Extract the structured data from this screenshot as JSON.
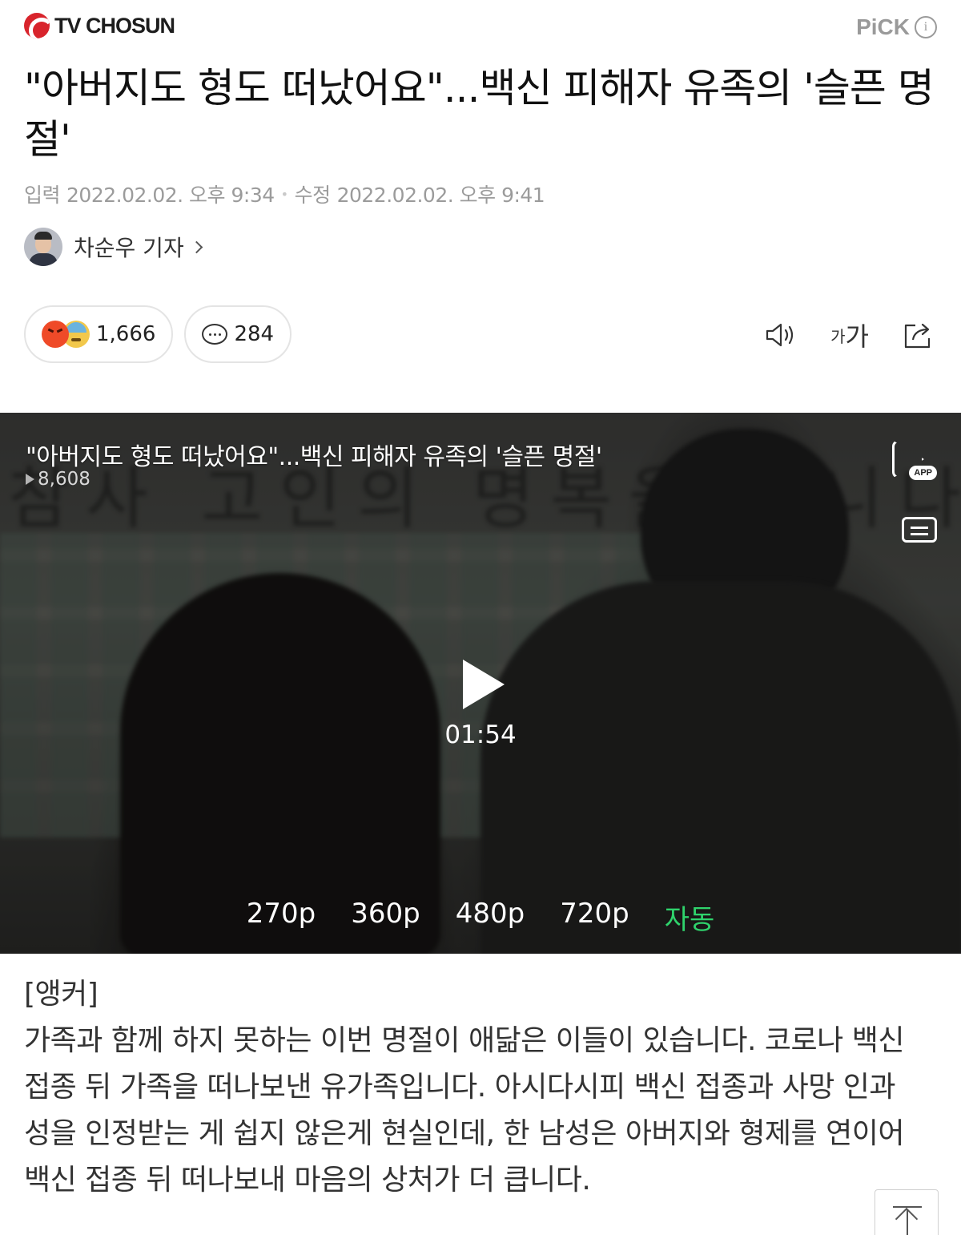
{
  "header": {
    "brand": "TV CHOSUN",
    "pick_label": "PiCK",
    "info_label": "i"
  },
  "article": {
    "title": "\"아버지도 형도 떠났어요\"...백신 피해자 유족의 '슬픈 명절'",
    "input_label": "입력",
    "input_date": "2022.02.02. 오후 9:34",
    "edit_label": "수정",
    "edit_date": "2022.02.02. 오후 9:41",
    "author": "차순우 기자"
  },
  "reactions": {
    "count": "1,666",
    "comments": "284"
  },
  "tools": {
    "font_small": "가",
    "font_large": "가"
  },
  "video": {
    "title": "\"아버지도 형도 떠났어요\"...백신 피해자 유족의 '슬픈 명절'",
    "views": "8,608",
    "app_badge": "APP",
    "duration": "01:54",
    "qualities": [
      "270p",
      "360p",
      "480p",
      "720p",
      "자동"
    ],
    "active_quality": "자동",
    "background_text": "참사 고인의 명복을 빕니다"
  },
  "body": {
    "label": "[앵커]",
    "paragraph": "가족과 함께 하지 못하는 이번 명절이 애닮은 이들이 있습니다. 코로나 백신\n접종 뒤 가족을 떠나보낸 유가족입니다. 아시다시피 백신 접종과 사망 인과\n성을 인정받는 게 쉽지 않은게 현실인데, 한 남성은 아버지와 형제를 연이어\n백신 접종 뒤 떠나보내 마음의 상처가 더 큽니다."
  },
  "colors": {
    "brand_red": "#d8242c",
    "active_quality": "#2fd36c",
    "meta_gray": "#9b9b9b"
  }
}
